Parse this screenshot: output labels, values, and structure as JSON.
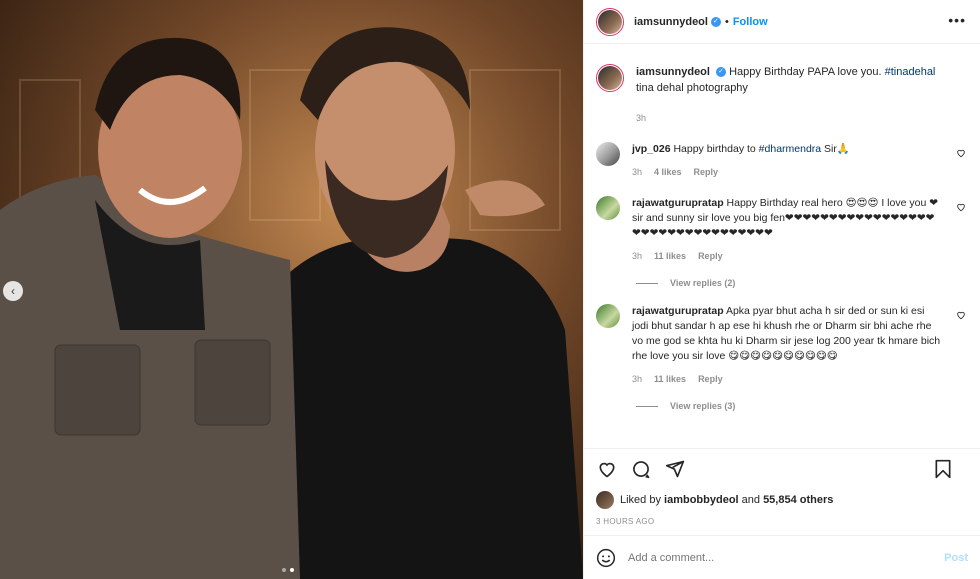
{
  "header": {
    "username": "iamsunnydeol",
    "separator": "•",
    "follow_label": "Follow",
    "more_label": "•••"
  },
  "photo": {
    "prev_label": "‹",
    "slide_count": 2,
    "active_slide": 1
  },
  "caption": {
    "username": "iamsunnydeol",
    "text": "Happy Birthday PAPA love you.",
    "tag": "#tinadehal",
    "text_after": " tina dehal photography",
    "time": "3h"
  },
  "comments": [
    {
      "username": "jvp_026",
      "text_before": "Happy birthday to ",
      "tag": "#dharmendra",
      "text_after": " Sir🙏",
      "time": "3h",
      "likes": "4 likes",
      "reply": "Reply"
    },
    {
      "username": "rajawatgurupratap",
      "text": "Happy Birthday real hero 😍😍😍 I love you ❤ sir and sunny sir love you big fen❤❤❤❤❤❤❤❤❤❤❤❤❤❤❤❤❤❤❤❤❤❤❤❤❤❤❤❤❤❤❤❤❤",
      "time": "3h",
      "likes": "11 likes",
      "reply": "Reply",
      "view_replies": "View replies (2)"
    },
    {
      "username": "rajawatgurupratap",
      "text": "Apka pyar bhut acha h sir ded or sun ki esi jodi bhut sandar h ap ese hi khush rhe or Dharm sir bhi ache rhe vo me god se khta hu ki Dharm sir jese log 200 year tk hmare bich rhe love you sir love 😋😋😋😋😋😋😋😋😋😋",
      "time": "3h",
      "likes": "11 likes",
      "reply": "Reply",
      "view_replies": "View replies (3)"
    }
  ],
  "likes": {
    "prefix": "Liked by ",
    "user": "iambobbydeol",
    "middle": " and ",
    "count": "55,854 others"
  },
  "posted_time": "3 HOURS AGO",
  "add_comment": {
    "placeholder": "Add a comment...",
    "post_label": "Post"
  },
  "icons": {
    "like": "heart-icon",
    "comment": "comment-icon",
    "share": "share-icon",
    "save": "bookmark-icon",
    "emoji": "smiley-icon"
  },
  "colors": {
    "link": "#0095f6",
    "hashtag": "#00376b",
    "muted": "#8e8e8e",
    "text": "#262626"
  }
}
